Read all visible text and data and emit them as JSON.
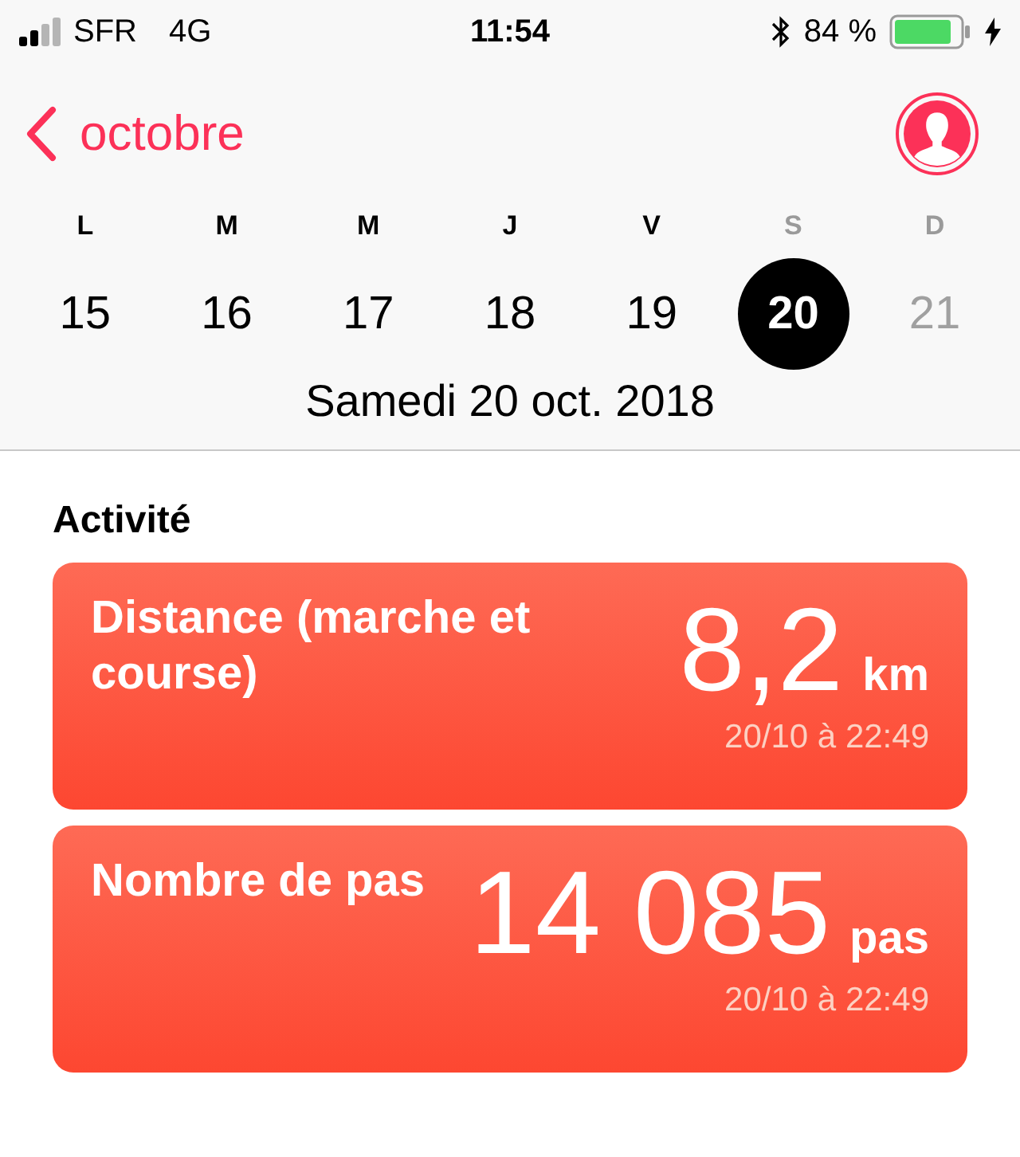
{
  "status_bar": {
    "carrier": "SFR",
    "network": "4G",
    "time": "11:54",
    "battery": "84 %",
    "charging": true
  },
  "nav": {
    "back_label": "octobre"
  },
  "weekdays": [
    {
      "label": "L",
      "dimmed": false
    },
    {
      "label": "M",
      "dimmed": false
    },
    {
      "label": "M",
      "dimmed": false
    },
    {
      "label": "J",
      "dimmed": false
    },
    {
      "label": "V",
      "dimmed": false
    },
    {
      "label": "S",
      "dimmed": true
    },
    {
      "label": "D",
      "dimmed": true
    }
  ],
  "days": [
    {
      "label": "15",
      "selected": false,
      "disabled": false
    },
    {
      "label": "16",
      "selected": false,
      "disabled": false
    },
    {
      "label": "17",
      "selected": false,
      "disabled": false
    },
    {
      "label": "18",
      "selected": false,
      "disabled": false
    },
    {
      "label": "19",
      "selected": false,
      "disabled": false
    },
    {
      "label": "20",
      "selected": true,
      "disabled": false
    },
    {
      "label": "21",
      "selected": false,
      "disabled": true
    }
  ],
  "date_title": "Samedi 20 oct. 2018",
  "section": {
    "title": "Activité"
  },
  "cards": [
    {
      "label": "Distance (marche et course)",
      "value": "8,2",
      "unit": "km",
      "timestamp": "20/10 à 22:49"
    },
    {
      "label": "Nombre de pas",
      "value": "14 085",
      "unit": "pas",
      "timestamp": "20/10 à 22:49"
    }
  ]
}
